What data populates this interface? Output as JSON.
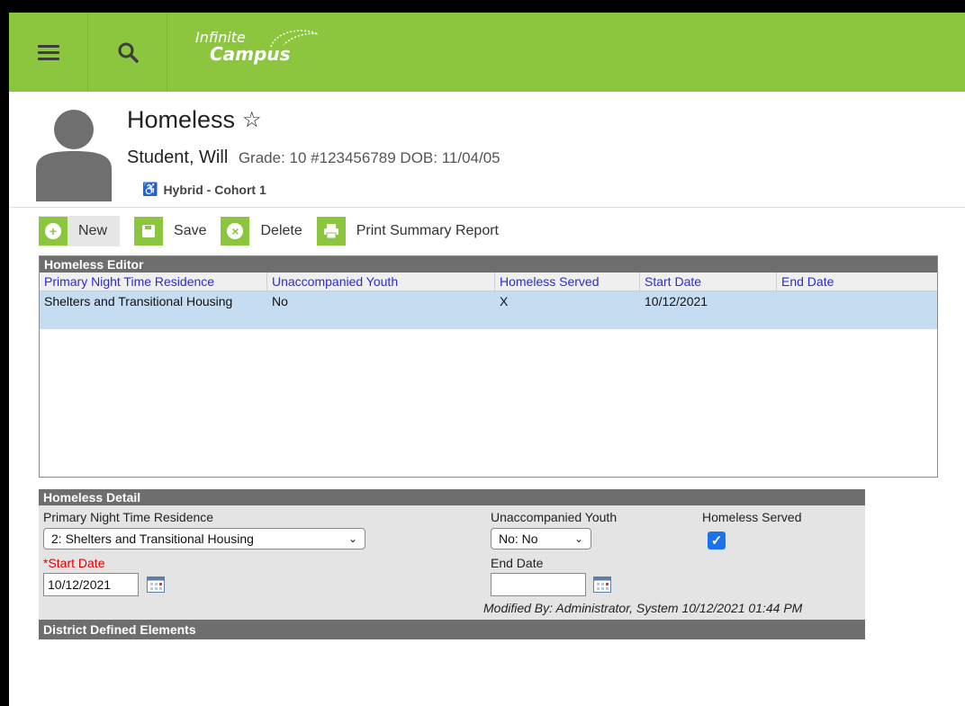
{
  "header": {
    "logo_line1": "Infinite",
    "logo_line2": "Campus",
    "page_title": "Homeless",
    "student_name": "Student, Will",
    "student_meta": "Grade: 10 #123456789 DOB: 11/04/05",
    "cohort": "Hybrid - Cohort 1"
  },
  "toolbar": {
    "new_label": "New",
    "save_label": "Save",
    "delete_label": "Delete",
    "print_label": "Print Summary Report"
  },
  "editor": {
    "title": "Homeless Editor",
    "columns": [
      "Primary Night Time Residence",
      "Unaccompanied Youth",
      "Homeless Served",
      "Start Date",
      "End Date"
    ],
    "rows": [
      [
        "Shelters and Transitional Housing",
        "No",
        "X",
        "10/12/2021",
        ""
      ]
    ]
  },
  "detail": {
    "title": "Homeless Detail",
    "residence_label": "Primary Night Time Residence",
    "residence_value": "2: Shelters and Transitional Housing",
    "unaccompanied_label": "Unaccompanied Youth",
    "unaccompanied_value": "No: No",
    "served_label": "Homeless Served",
    "served_checked": true,
    "start_date_label": "*Start Date",
    "start_date_value": "10/12/2021",
    "end_date_label": "End Date",
    "end_date_value": "",
    "modified": "Modified By: Administrator, System 10/12/2021 01:44 PM",
    "district_title": "District Defined Elements"
  },
  "colors": {
    "brand_green": "#8cc63f",
    "selected_row": "#c6dcf0",
    "header_gray": "#6e6e6e",
    "link_blue": "#2a2ad8"
  },
  "icons": {
    "menu": "hamburger-icon",
    "search": "search-icon",
    "favorite": "star-outline-icon",
    "cohort": "person-hybrid-icon",
    "new": "plus-icon",
    "save": "save-icon",
    "delete": "close-icon",
    "print": "printer-icon",
    "calendar": "calendar-icon"
  }
}
